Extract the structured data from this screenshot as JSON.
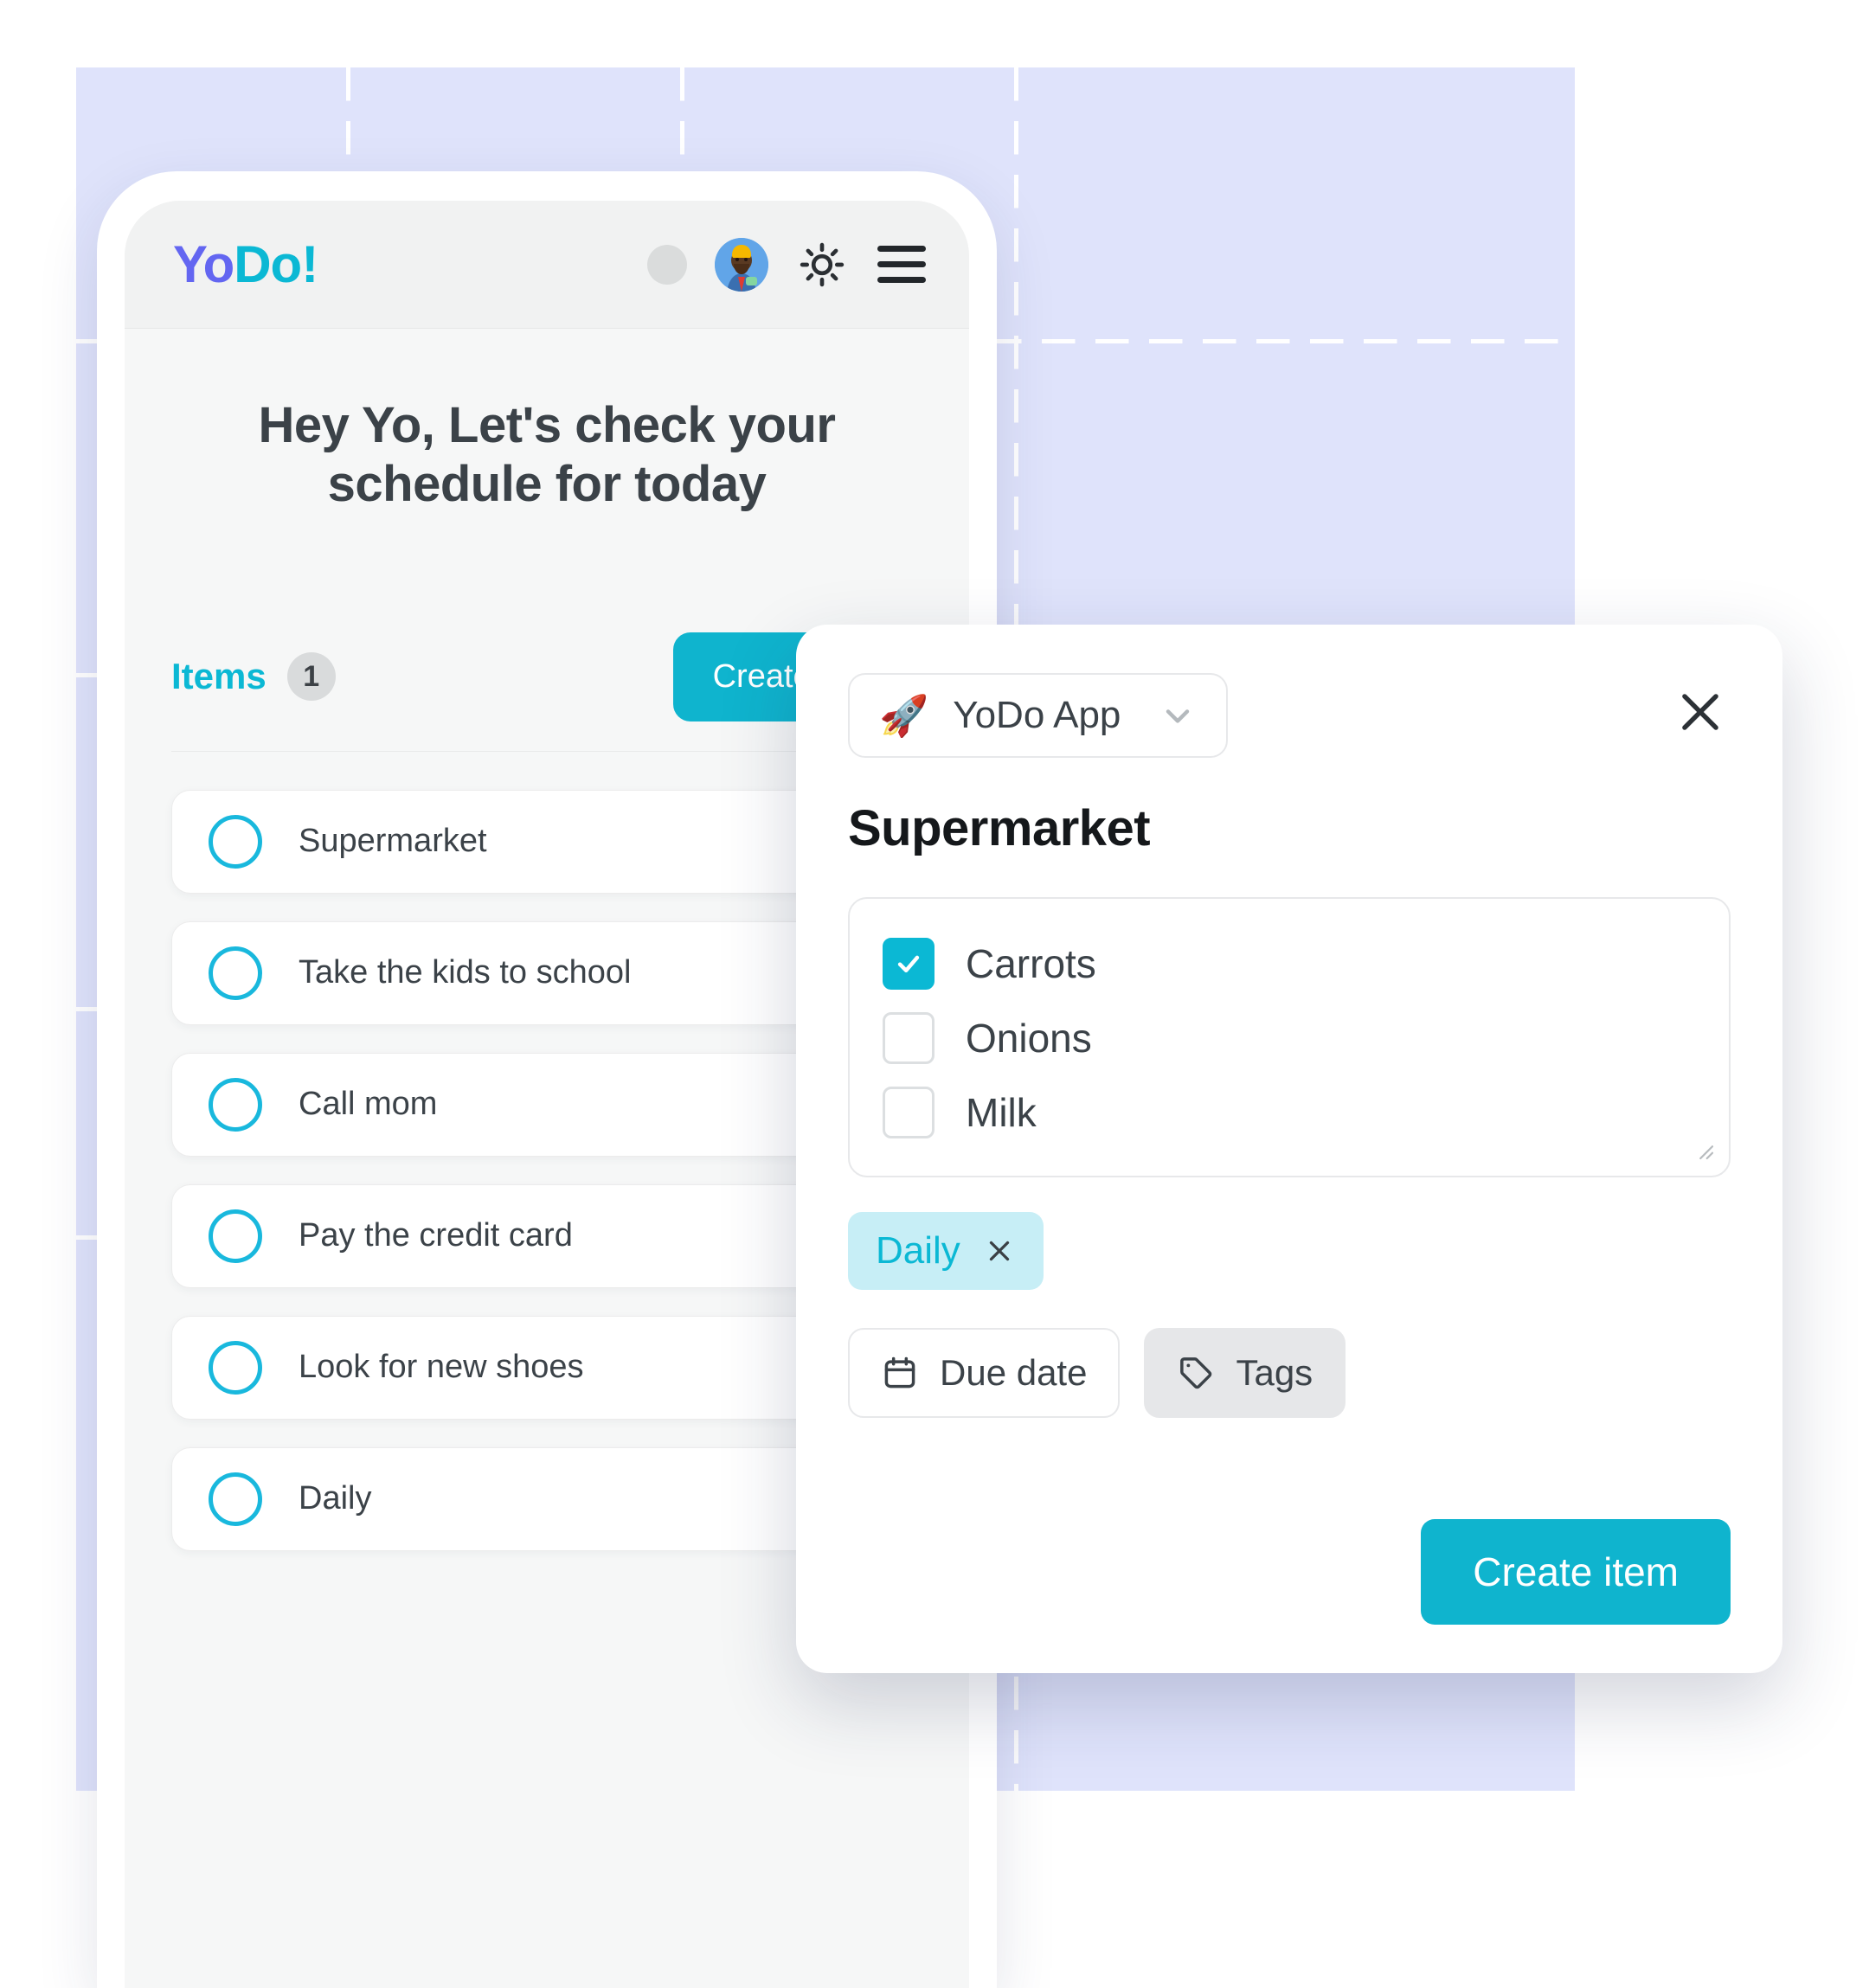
{
  "phone": {
    "logo": {
      "part1": "Yo",
      "part2": "Do!"
    },
    "appbar": {
      "avatar_name": "user-avatar",
      "theme_icon": "sun-icon",
      "menu_icon": "hamburger-menu-icon"
    },
    "greeting": "Hey Yo, Let's check your schedule for today",
    "items_label": "Items",
    "items_count": "1",
    "create_item_label": "Create item",
    "tasks": [
      {
        "label": "Supermarket"
      },
      {
        "label": "Take the kids to school"
      },
      {
        "label": "Call mom"
      },
      {
        "label": "Pay the credit card"
      },
      {
        "label": "Look for new shoes"
      },
      {
        "label": "Daily"
      }
    ]
  },
  "modal": {
    "app_selector": {
      "icon": "rocket-icon",
      "emoji": "🚀",
      "label": "YoDo App",
      "chevron": "chevron-down-icon"
    },
    "close_label": "close-icon",
    "title": "Supermarket",
    "checklist": [
      {
        "label": "Carrots",
        "checked": true
      },
      {
        "label": "Onions",
        "checked": false
      },
      {
        "label": "Milk",
        "checked": false
      }
    ],
    "tags": [
      {
        "label": "Daily",
        "remove_label": "remove-tag-icon"
      }
    ],
    "due_date_label": "Due date",
    "tags_button_label": "Tags",
    "create_item_label": "Create item"
  },
  "colors": {
    "backdrop": "#dfe3fb",
    "accent_cyan": "#0fb4ce",
    "accent_indigo": "#6366f1",
    "tag_chip_bg": "#c7eef6",
    "text_dark": "#3b4248"
  }
}
